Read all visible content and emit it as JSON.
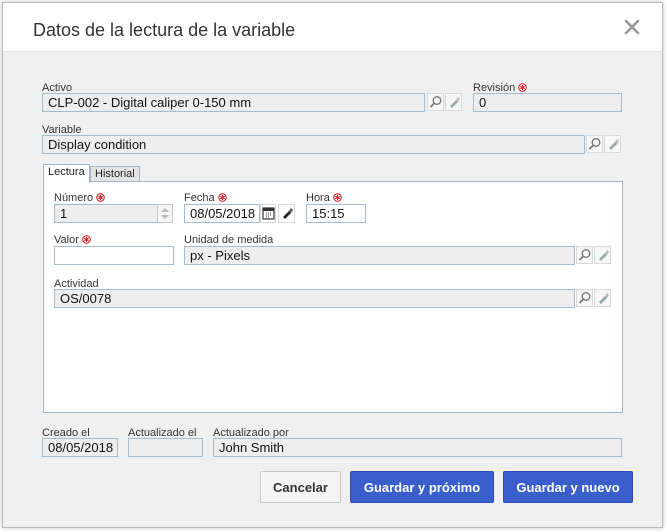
{
  "dialog": {
    "title": "Datos de la lectura de la variable"
  },
  "form": {
    "activo": {
      "label": "Activo",
      "value": "CLP-002 - Digital caliper 0-150 mm"
    },
    "revision": {
      "label": "Revisión",
      "value": "0"
    },
    "variable": {
      "label": "Variable",
      "value": "Display condition"
    }
  },
  "tabs": [
    {
      "label": "Lectura",
      "active": true
    },
    {
      "label": "Historial",
      "active": false
    }
  ],
  "lectura": {
    "numero": {
      "label": "Número",
      "value": "1"
    },
    "fecha": {
      "label": "Fecha",
      "value": "08/05/2018"
    },
    "hora": {
      "label": "Hora",
      "value": "15:15"
    },
    "valor": {
      "label": "Valor",
      "value": ""
    },
    "unidad": {
      "label": "Unidad de medida",
      "value": "px - Pixels"
    },
    "actividad": {
      "label": "Actividad",
      "value": "OS/0078"
    }
  },
  "footer": {
    "creado": {
      "label": "Creado el",
      "value": "08/05/2018"
    },
    "actualizado": {
      "label": "Actualizado el",
      "value": ""
    },
    "actualizado_por": {
      "label": "Actualizado por",
      "value": "John Smith"
    }
  },
  "buttons": {
    "cancel": "Cancelar",
    "save_next": "Guardar y próximo",
    "save_new": "Guardar y nuevo"
  },
  "colors": {
    "primary_button": "#3a5fcd",
    "required_marker": "#d9232b",
    "field_border": "#a8bcd0"
  },
  "icons": {
    "search": "magnifier-icon",
    "clear": "eraser-icon",
    "calendar": "calendar-icon",
    "required": "required-asterisk-icon",
    "close": "close-icon"
  }
}
